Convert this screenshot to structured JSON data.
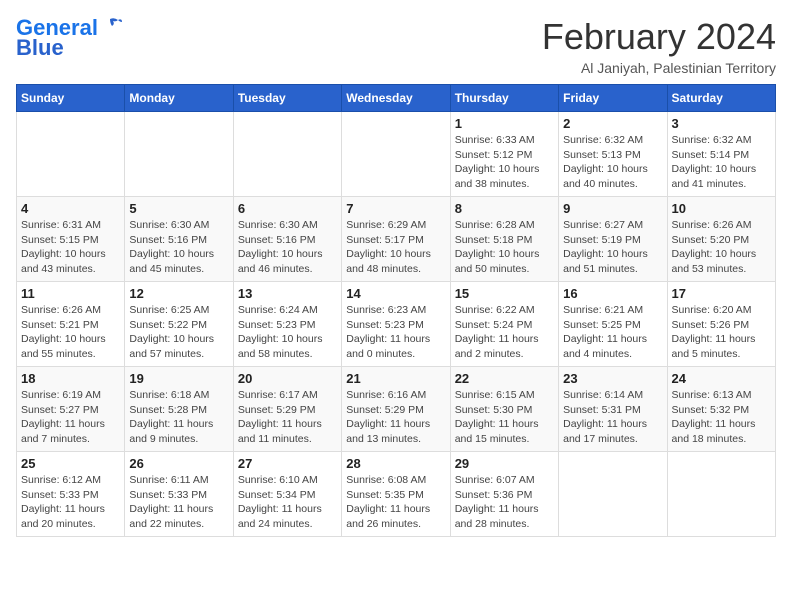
{
  "logo": {
    "line1": "General",
    "line2": "Blue"
  },
  "title": "February 2024",
  "location": "Al Janiyah, Palestinian Territory",
  "weekdays": [
    "Sunday",
    "Monday",
    "Tuesday",
    "Wednesday",
    "Thursday",
    "Friday",
    "Saturday"
  ],
  "weeks": [
    [
      {
        "day": "",
        "detail": ""
      },
      {
        "day": "",
        "detail": ""
      },
      {
        "day": "",
        "detail": ""
      },
      {
        "day": "",
        "detail": ""
      },
      {
        "day": "1",
        "detail": "Sunrise: 6:33 AM\nSunset: 5:12 PM\nDaylight: 10 hours\nand 38 minutes."
      },
      {
        "day": "2",
        "detail": "Sunrise: 6:32 AM\nSunset: 5:13 PM\nDaylight: 10 hours\nand 40 minutes."
      },
      {
        "day": "3",
        "detail": "Sunrise: 6:32 AM\nSunset: 5:14 PM\nDaylight: 10 hours\nand 41 minutes."
      }
    ],
    [
      {
        "day": "4",
        "detail": "Sunrise: 6:31 AM\nSunset: 5:15 PM\nDaylight: 10 hours\nand 43 minutes."
      },
      {
        "day": "5",
        "detail": "Sunrise: 6:30 AM\nSunset: 5:16 PM\nDaylight: 10 hours\nand 45 minutes."
      },
      {
        "day": "6",
        "detail": "Sunrise: 6:30 AM\nSunset: 5:16 PM\nDaylight: 10 hours\nand 46 minutes."
      },
      {
        "day": "7",
        "detail": "Sunrise: 6:29 AM\nSunset: 5:17 PM\nDaylight: 10 hours\nand 48 minutes."
      },
      {
        "day": "8",
        "detail": "Sunrise: 6:28 AM\nSunset: 5:18 PM\nDaylight: 10 hours\nand 50 minutes."
      },
      {
        "day": "9",
        "detail": "Sunrise: 6:27 AM\nSunset: 5:19 PM\nDaylight: 10 hours\nand 51 minutes."
      },
      {
        "day": "10",
        "detail": "Sunrise: 6:26 AM\nSunset: 5:20 PM\nDaylight: 10 hours\nand 53 minutes."
      }
    ],
    [
      {
        "day": "11",
        "detail": "Sunrise: 6:26 AM\nSunset: 5:21 PM\nDaylight: 10 hours\nand 55 minutes."
      },
      {
        "day": "12",
        "detail": "Sunrise: 6:25 AM\nSunset: 5:22 PM\nDaylight: 10 hours\nand 57 minutes."
      },
      {
        "day": "13",
        "detail": "Sunrise: 6:24 AM\nSunset: 5:23 PM\nDaylight: 10 hours\nand 58 minutes."
      },
      {
        "day": "14",
        "detail": "Sunrise: 6:23 AM\nSunset: 5:23 PM\nDaylight: 11 hours\nand 0 minutes."
      },
      {
        "day": "15",
        "detail": "Sunrise: 6:22 AM\nSunset: 5:24 PM\nDaylight: 11 hours\nand 2 minutes."
      },
      {
        "day": "16",
        "detail": "Sunrise: 6:21 AM\nSunset: 5:25 PM\nDaylight: 11 hours\nand 4 minutes."
      },
      {
        "day": "17",
        "detail": "Sunrise: 6:20 AM\nSunset: 5:26 PM\nDaylight: 11 hours\nand 5 minutes."
      }
    ],
    [
      {
        "day": "18",
        "detail": "Sunrise: 6:19 AM\nSunset: 5:27 PM\nDaylight: 11 hours\nand 7 minutes."
      },
      {
        "day": "19",
        "detail": "Sunrise: 6:18 AM\nSunset: 5:28 PM\nDaylight: 11 hours\nand 9 minutes."
      },
      {
        "day": "20",
        "detail": "Sunrise: 6:17 AM\nSunset: 5:29 PM\nDaylight: 11 hours\nand 11 minutes."
      },
      {
        "day": "21",
        "detail": "Sunrise: 6:16 AM\nSunset: 5:29 PM\nDaylight: 11 hours\nand 13 minutes."
      },
      {
        "day": "22",
        "detail": "Sunrise: 6:15 AM\nSunset: 5:30 PM\nDaylight: 11 hours\nand 15 minutes."
      },
      {
        "day": "23",
        "detail": "Sunrise: 6:14 AM\nSunset: 5:31 PM\nDaylight: 11 hours\nand 17 minutes."
      },
      {
        "day": "24",
        "detail": "Sunrise: 6:13 AM\nSunset: 5:32 PM\nDaylight: 11 hours\nand 18 minutes."
      }
    ],
    [
      {
        "day": "25",
        "detail": "Sunrise: 6:12 AM\nSunset: 5:33 PM\nDaylight: 11 hours\nand 20 minutes."
      },
      {
        "day": "26",
        "detail": "Sunrise: 6:11 AM\nSunset: 5:33 PM\nDaylight: 11 hours\nand 22 minutes."
      },
      {
        "day": "27",
        "detail": "Sunrise: 6:10 AM\nSunset: 5:34 PM\nDaylight: 11 hours\nand 24 minutes."
      },
      {
        "day": "28",
        "detail": "Sunrise: 6:08 AM\nSunset: 5:35 PM\nDaylight: 11 hours\nand 26 minutes."
      },
      {
        "day": "29",
        "detail": "Sunrise: 6:07 AM\nSunset: 5:36 PM\nDaylight: 11 hours\nand 28 minutes."
      },
      {
        "day": "",
        "detail": ""
      },
      {
        "day": "",
        "detail": ""
      }
    ]
  ]
}
